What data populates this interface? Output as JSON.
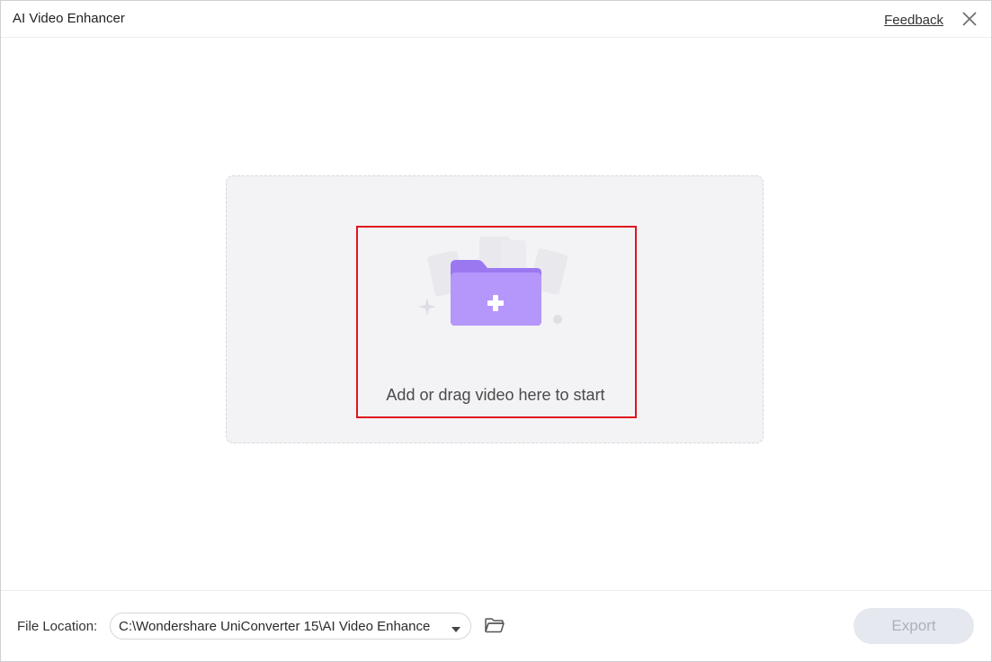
{
  "window": {
    "title": "AI Video Enhancer",
    "feedback_label": "Feedback",
    "close_icon": "close-icon"
  },
  "dropzone": {
    "hint": "Add or drag video here to start",
    "icon": "add-folder-icon"
  },
  "footer": {
    "file_location_label": "File Location:",
    "path_value": "C:\\Wondershare UniConverter 15\\AI Video Enhance",
    "open_folder_icon": "folder-icon",
    "export_label": "Export",
    "export_enabled": false
  },
  "colors": {
    "highlight": "#e0141e",
    "folder_accent": "#a985f6",
    "export_bg": "#e6e8ef",
    "export_text": "#aeb1bb"
  }
}
